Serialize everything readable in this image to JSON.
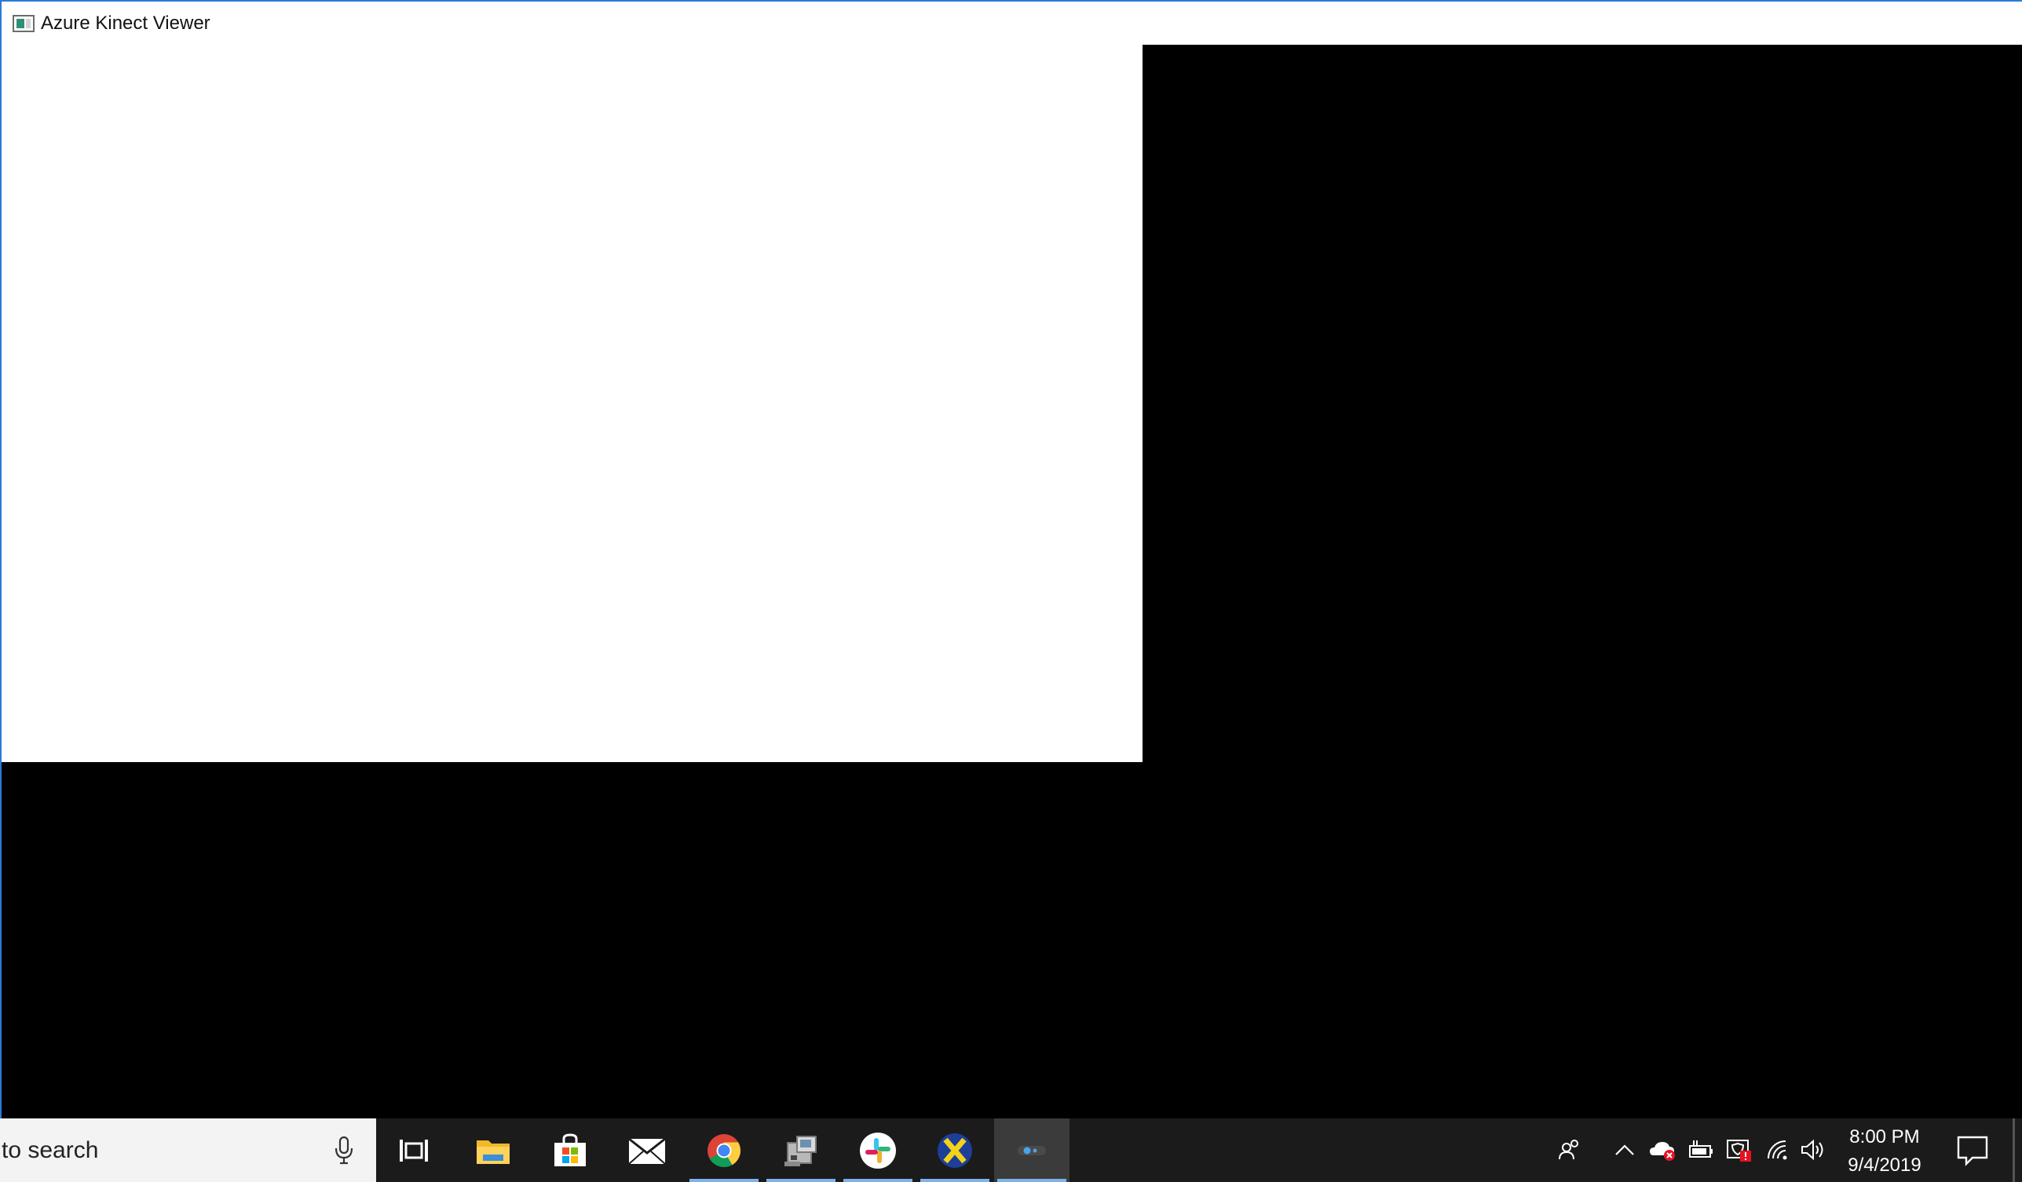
{
  "window": {
    "title": "Azure Kinect Viewer",
    "icon": "azure-kinect-viewer-app-icon"
  },
  "taskbar": {
    "search_text": "to search",
    "pinned_apps": [
      {
        "name": "task-view-icon",
        "active": false
      },
      {
        "name": "file-explorer-icon",
        "active": false
      },
      {
        "name": "microsoft-store-icon",
        "active": false
      },
      {
        "name": "mail-icon",
        "active": false
      },
      {
        "name": "chrome-icon",
        "active": true
      },
      {
        "name": "device-manager-icon",
        "active": true
      },
      {
        "name": "slack-icon",
        "active": true
      },
      {
        "name": "xming-x-icon",
        "active": true
      },
      {
        "name": "azure-kinect-viewer-taskbar-icon",
        "active": true
      }
    ],
    "tray": {
      "time": "8:00 PM",
      "date": "9/4/2019",
      "icons": [
        "people-icon",
        "show-hidden-icons-chevron",
        "onedrive-error-icon",
        "battery-icon",
        "security-alert-icon",
        "wifi-icon",
        "volume-icon",
        "action-center-icon"
      ]
    }
  },
  "colors": {
    "window_border": "#2b79d8",
    "taskbar_bg": "#1b1b1b",
    "search_bg": "#f3f3f3",
    "active_underline": "#7fb2ea"
  }
}
